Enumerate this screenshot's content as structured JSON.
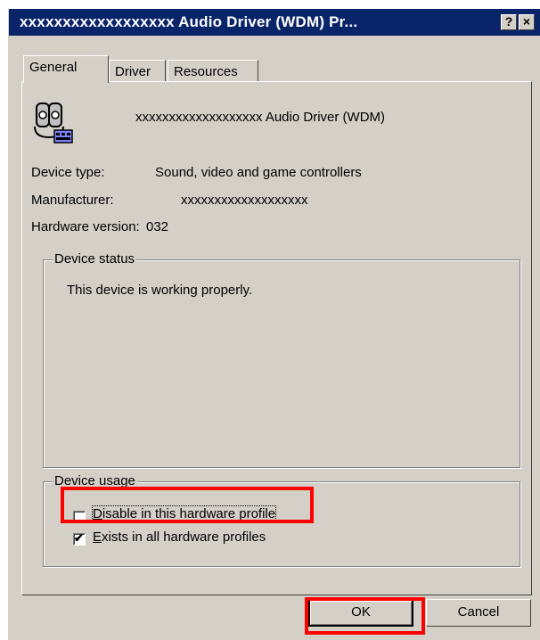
{
  "window": {
    "title": "xxxxxxxxxxxxxxxxxx  Audio Driver (WDM) Pr...",
    "help_glyph": "?",
    "close_glyph": "×"
  },
  "tabs": [
    {
      "label": "General",
      "active": true
    },
    {
      "label": "Driver",
      "active": false
    },
    {
      "label": "Resources",
      "active": false
    }
  ],
  "device": {
    "name": "xxxxxxxxxxxxxxxxxxx  Audio Driver (WDM)",
    "icon": "sound-device-icon"
  },
  "properties": {
    "type_label": "Device type:",
    "type_value": "Sound, video and game controllers",
    "manufacturer_label": "Manufacturer:",
    "manufacturer_value": "xxxxxxxxxxxxxxxxxxx",
    "hardware_label": "Hardware version:",
    "hardware_value": "032"
  },
  "status": {
    "title": "Device status",
    "text": "This device is working properly."
  },
  "usage": {
    "title": "Device usage",
    "options": [
      {
        "label_prefix": "",
        "label_underlined": "D",
        "label_rest": "isable in this hardware profile",
        "checked": false
      },
      {
        "label_prefix": "",
        "label_underlined": "E",
        "label_rest": "xists in all hardware profiles",
        "checked": true
      }
    ]
  },
  "buttons": {
    "ok": "OK",
    "cancel": "Cancel"
  },
  "colors": {
    "titlebar": "#0a246a",
    "face": "#d4d0c8",
    "highlight": "#ff0000"
  }
}
